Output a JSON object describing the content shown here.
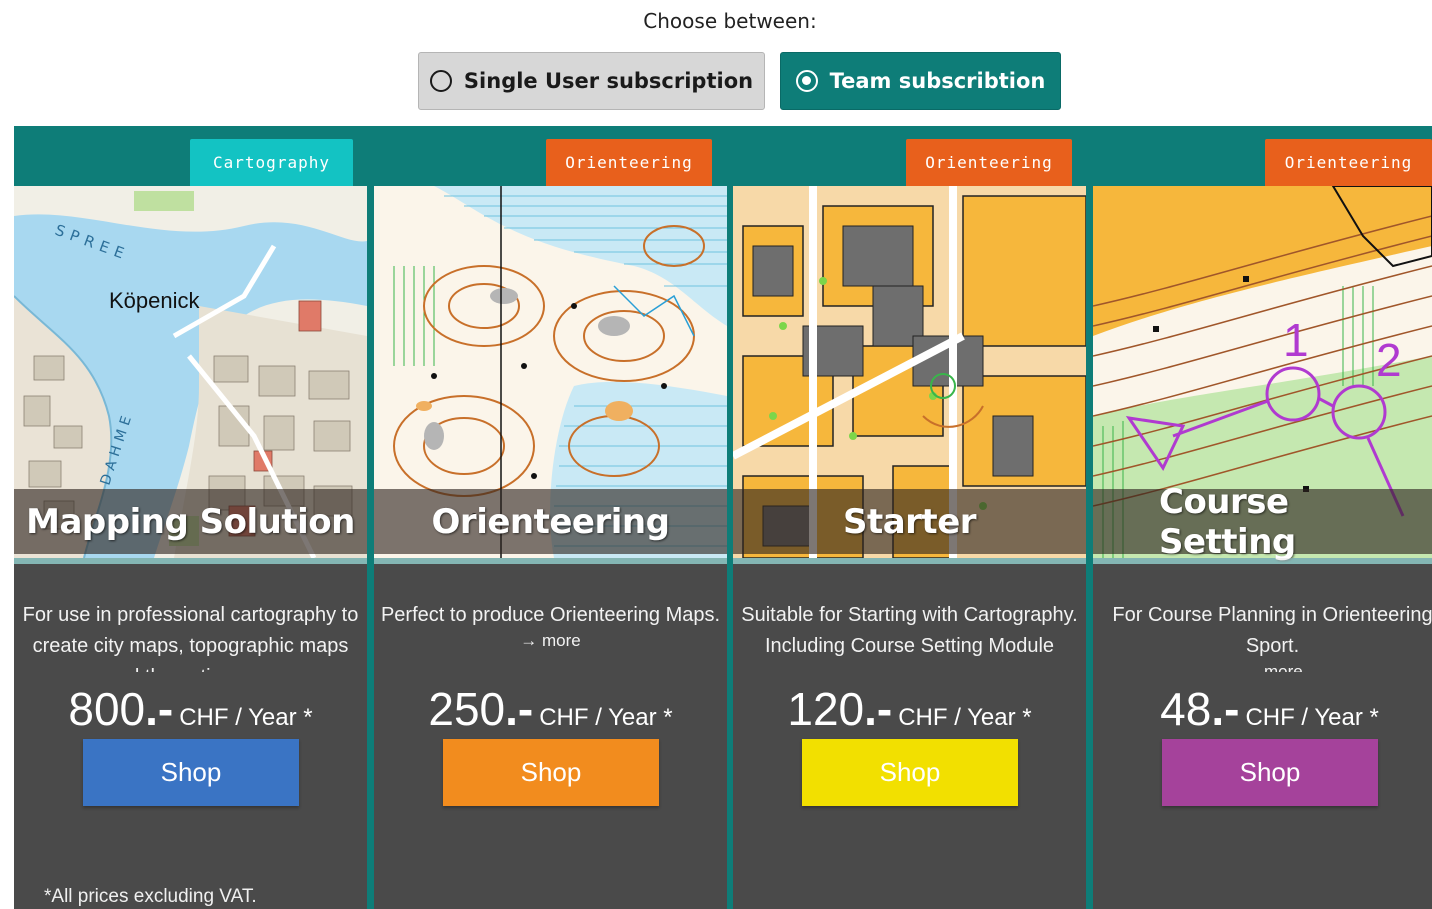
{
  "header": {
    "choose_label": "Choose between:",
    "options": [
      {
        "label": "Single User subscription",
        "selected": false
      },
      {
        "label": "Team subscribtion",
        "selected": true
      }
    ]
  },
  "colors": {
    "teal": "#0e7d78",
    "tag_cartography": "#13c3c3",
    "tag_orienteering": "#e8601c",
    "card_body": "#4a4a4a"
  },
  "cards": [
    {
      "tag": "Cartography",
      "title": "Mapping Solution",
      "description": "For use in professional cartography to create city maps, topographic maps and thematic maps",
      "more": "",
      "price": "800",
      "price_suffix": ".-",
      "price_unit": "CHF / Year *",
      "shop_label": "Shop",
      "button_color": "#3a74c4",
      "map_labels": [
        "SPREE",
        "Köpenick",
        "DAHME"
      ]
    },
    {
      "tag": "Orienteering",
      "title": "Orienteering",
      "description": "Perfect to produce Orienteering Maps.",
      "more": "more",
      "price": "250",
      "price_suffix": ".-",
      "price_unit": "CHF / Year *",
      "shop_label": "Shop",
      "button_color": "#f28c1e"
    },
    {
      "tag": "Orienteering",
      "title": "Starter",
      "description": "Suitable for Starting with Cartography. Including Course Setting Module",
      "more": "",
      "price": "120",
      "price_suffix": ".-",
      "price_unit": "CHF / Year *",
      "shop_label": "Shop",
      "button_color": "#f2e000"
    },
    {
      "tag": "Orienteering",
      "title": "Course Setting",
      "description": "For Course Planning in Orienteering Sport.",
      "more": "more",
      "price": "48",
      "price_suffix": ".-",
      "price_unit": "CHF / Year *",
      "shop_label": "Shop",
      "button_color": "#a5429b",
      "map_labels": [
        "1",
        "2"
      ]
    }
  ],
  "footnote": "*All prices excluding VAT."
}
